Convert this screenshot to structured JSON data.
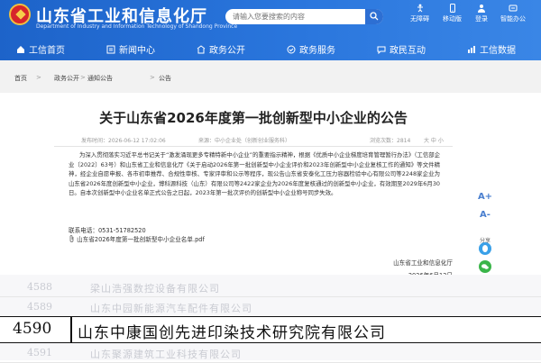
{
  "header": {
    "site_title": "山东省工业和信息化厅",
    "site_subtitle": "Department of Industry and Information Technology of Shandong Province",
    "search_placeholder": "请输入您要搜索的内容",
    "top_links": [
      {
        "label": "无障碍",
        "icon": "accessibility-icon"
      },
      {
        "label": "移动版",
        "icon": "mobile-icon"
      },
      {
        "label": "登录",
        "icon": "user-icon"
      },
      {
        "label": "智能办公",
        "icon": "office-icon"
      }
    ],
    "nav": [
      {
        "label": "工信首页",
        "icon": "home-icon"
      },
      {
        "label": "新闻中心",
        "icon": "news-icon"
      },
      {
        "label": "政务公开",
        "icon": "open-gov-icon"
      },
      {
        "label": "政务服务",
        "icon": "service-icon"
      },
      {
        "label": "政民互动",
        "icon": "interaction-icon"
      },
      {
        "label": "工信数据",
        "icon": "data-icon"
      }
    ],
    "colors": {
      "brand_blue": "#1d63c9",
      "emblem_red": "#d7262b"
    }
  },
  "breadcrumb": [
    "首页",
    "政务公开",
    "通知公告",
    "公告"
  ],
  "article": {
    "title": "关于山东省2026年度第一批创新型中小企业的公告",
    "meta": {
      "date": "发布时间：2026-06-12 17:02:06",
      "source": "来源：中小企业处（创新创业服务科）",
      "views": "浏览次数：2814",
      "font_ctrl": "大 中 小"
    },
    "body": "为深入贯彻落实习近平总书记关于“激发涌现更多专精特新中小企业”的重要指示精神，根据《优质中小企业梯度培育管理暂行办法》（工信部企业〔2022〕63号）和山东省工业和信息化厅《关于启动2026年第一批创新型中小企业评价和2023年创新型中小企业复核工作的通知》等文件精神，经企业自愿申报、各市初审推荐、合规性审核、专家评审和公示等程序，现公告山东省安泰化工压力容器检验中心有限公司等2248家企业为山东省2026年度创新型中小企业，博科源科技（山东）有限公司等2422家企业为2026年度复核通过的创新型中小企业，有效期至2029年6月30日。自本次创新型中小企业名单正式公告之日起，2023年第一批次评价的创新型中小企业称号同步失效。",
    "contact": "联系电话：0531-51782520",
    "attachment": "山东省2026年度第一批创新型中小企业名单.pdf",
    "signature_org": "山东省工业和信息化厅",
    "signature_date": "2026年6月12日"
  },
  "tools": [
    {
      "label": "",
      "icon": "font-increase-icon",
      "glyph": "A+"
    },
    {
      "label": "",
      "icon": "font-decrease-icon",
      "glyph": "A-"
    },
    {
      "label": "分享",
      "icon": "share-icon",
      "glyph": ""
    },
    {
      "label": "",
      "icon": "qq-icon",
      "glyph": ""
    },
    {
      "label": "",
      "icon": "wechat-icon",
      "glyph": ""
    }
  ],
  "overlay_list": {
    "blurred_rows": [
      {
        "num": "4588",
        "name": "梁山浩强数控设备有限公司"
      },
      {
        "num": "4589",
        "name": "山东中园新能源汽车配件有限公司"
      },
      {
        "num": "4591",
        "name": "山东聚源建筑工业科技有限公司"
      }
    ],
    "highlight": {
      "num": "4590",
      "name": "山东中康国创先进印染技术研究院有限公司"
    }
  }
}
